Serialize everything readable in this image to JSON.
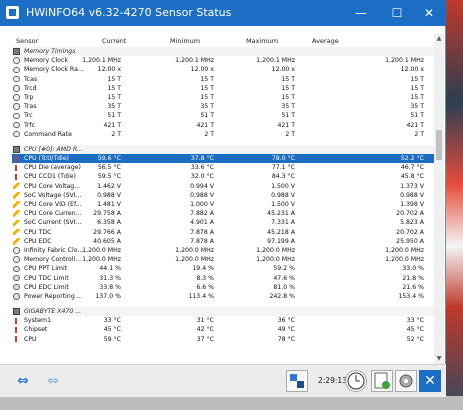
{
  "window": {
    "title": "HWiNFO64 v6.32-4270 Sensor Status",
    "minimize": "—",
    "maximize": "☐",
    "close": "✕"
  },
  "columns": {
    "sensor": "Sensor",
    "current": "Current",
    "minimum": "Minimum",
    "maximum": "Maximum",
    "average": "Average"
  },
  "rows": [
    {
      "type": "group",
      "icon": "chip",
      "name": "Memory Timings"
    },
    {
      "type": "row",
      "icon": "clock",
      "name": "Memory Clock",
      "c": "1,200.1 MHz",
      "min": "1,200.1 MHz",
      "max": "1,200.1 MHz",
      "avg": "1,200.1 MHz"
    },
    {
      "type": "row",
      "icon": "clock",
      "name": "Memory Clock Ra...",
      "c": "12.00 x",
      "min": "12.00 x",
      "max": "12.00 x",
      "avg": "12.00 x"
    },
    {
      "type": "row",
      "icon": "clock",
      "name": "Tcas",
      "c": "15 T",
      "min": "15 T",
      "max": "15 T",
      "avg": "15 T"
    },
    {
      "type": "row",
      "icon": "clock",
      "name": "Trcd",
      "c": "15 T",
      "min": "15 T",
      "max": "15 T",
      "avg": "15 T"
    },
    {
      "type": "row",
      "icon": "clock",
      "name": "Trp",
      "c": "15 T",
      "min": "15 T",
      "max": "15 T",
      "avg": "15 T"
    },
    {
      "type": "row",
      "icon": "clock",
      "name": "Tras",
      "c": "35 T",
      "min": "35 T",
      "max": "35 T",
      "avg": "35 T"
    },
    {
      "type": "row",
      "icon": "clock",
      "name": "Trc",
      "c": "51 T",
      "min": "51 T",
      "max": "51 T",
      "avg": "51 T"
    },
    {
      "type": "row",
      "icon": "clock",
      "name": "Trfc",
      "c": "421 T",
      "min": "421 T",
      "max": "421 T",
      "avg": "421 T"
    },
    {
      "type": "row",
      "icon": "clock",
      "name": "Command Rate",
      "c": "2 T",
      "min": "2 T",
      "max": "2 T",
      "avg": "2 T"
    },
    {
      "type": "sep"
    },
    {
      "type": "group",
      "icon": "chip",
      "name": "CPU [#0]: AMD R..."
    },
    {
      "type": "sel",
      "icon": "temp",
      "name": "CPU (Tctl/Tdie)",
      "c": "59.6 °C",
      "min": "37.8 °C",
      "max": "78.0 °C",
      "avg": "52.2 °C"
    },
    {
      "type": "row",
      "icon": "temp",
      "name": "CPU Die (average)",
      "c": "56.5 °C",
      "min": "33.6 °C",
      "max": "77.1 °C",
      "avg": "46.7 °C"
    },
    {
      "type": "row",
      "icon": "temp",
      "name": "CPU CCD1 (Tdie)",
      "c": "59.5 °C",
      "min": "32.0 °C",
      "max": "84.3 °C",
      "avg": "45.8 °C"
    },
    {
      "type": "row",
      "icon": "volt",
      "name": "CPU Core Voltag...",
      "c": "1.462 V",
      "min": "0.994 V",
      "max": "1.500 V",
      "avg": "1.373 V"
    },
    {
      "type": "row",
      "icon": "volt",
      "name": "SoC Voltage (SVI...",
      "c": "0.988 V",
      "min": "0.988 V",
      "max": "0.988 V",
      "avg": "0.988 V"
    },
    {
      "type": "row",
      "icon": "volt",
      "name": "CPU Core VID (Ef...",
      "c": "1.481 V",
      "min": "1.000 V",
      "max": "1.500 V",
      "avg": "1.398 V"
    },
    {
      "type": "row",
      "icon": "volt",
      "name": "CPU Core Curren...",
      "c": "29.758 A",
      "min": "7.882 A",
      "max": "45.231 A",
      "avg": "20.702 A"
    },
    {
      "type": "row",
      "icon": "volt",
      "name": "SoC Current (SVI...",
      "c": "6.358 A",
      "min": "4.901 A",
      "max": "7.331 A",
      "avg": "5.823 A"
    },
    {
      "type": "row",
      "icon": "volt",
      "name": "CPU TDC",
      "c": "29.766 A",
      "min": "7.878 A",
      "max": "45.218 A",
      "avg": "20.702 A"
    },
    {
      "type": "row",
      "icon": "volt",
      "name": "CPU EDC",
      "c": "40.605 A",
      "min": "7.878 A",
      "max": "97.199 A",
      "avg": "25.950 A"
    },
    {
      "type": "row",
      "icon": "clock",
      "name": "Infinity Fabric Clo...",
      "c": "1,200.0 MHz",
      "min": "1,200.0 MHz",
      "max": "1,200.0 MHz",
      "avg": "1,200.0 MHz"
    },
    {
      "type": "row",
      "icon": "clock",
      "name": "Memory Controll...",
      "c": "1,200.0 MHz",
      "min": "1,200.0 MHz",
      "max": "1,200.0 MHz",
      "avg": "1,200.0 MHz"
    },
    {
      "type": "row",
      "icon": "usage",
      "name": "CPU PPT Limit",
      "c": "44.1 %",
      "min": "19.4 %",
      "max": "59.2 %",
      "avg": "33.0 %"
    },
    {
      "type": "row",
      "icon": "usage",
      "name": "CPU TDC Limit",
      "c": "31.3 %",
      "min": "8.3 %",
      "max": "47.6 %",
      "avg": "21.8 %"
    },
    {
      "type": "row",
      "icon": "usage",
      "name": "CPU EDC Limit",
      "c": "33.8 %",
      "min": "6.6 %",
      "max": "81.0 %",
      "avg": "21.6 %"
    },
    {
      "type": "row",
      "icon": "usage",
      "name": "Power Reporting ...",
      "c": "137.0 %",
      "min": "113.4 %",
      "max": "242.8 %",
      "avg": "153.4 %"
    },
    {
      "type": "sep"
    },
    {
      "type": "group",
      "icon": "chip",
      "name": "GIGABYTE X470 ..."
    },
    {
      "type": "row",
      "icon": "temp",
      "name": "System1",
      "c": "33 °C",
      "min": "31 °C",
      "max": "36 °C",
      "avg": "33 °C"
    },
    {
      "type": "row",
      "icon": "temp",
      "name": "Chipset",
      "c": "45 °C",
      "min": "42 °C",
      "max": "49 °C",
      "avg": "45 °C"
    },
    {
      "type": "row",
      "icon": "temp",
      "name": "CPU",
      "c": "59 °C",
      "min": "37 °C",
      "max": "78 °C",
      "avg": "52 °C"
    }
  ],
  "toolbar": {
    "nav_left": "⇔",
    "nav_right": "⇔",
    "elapsed": "2:29:13"
  }
}
